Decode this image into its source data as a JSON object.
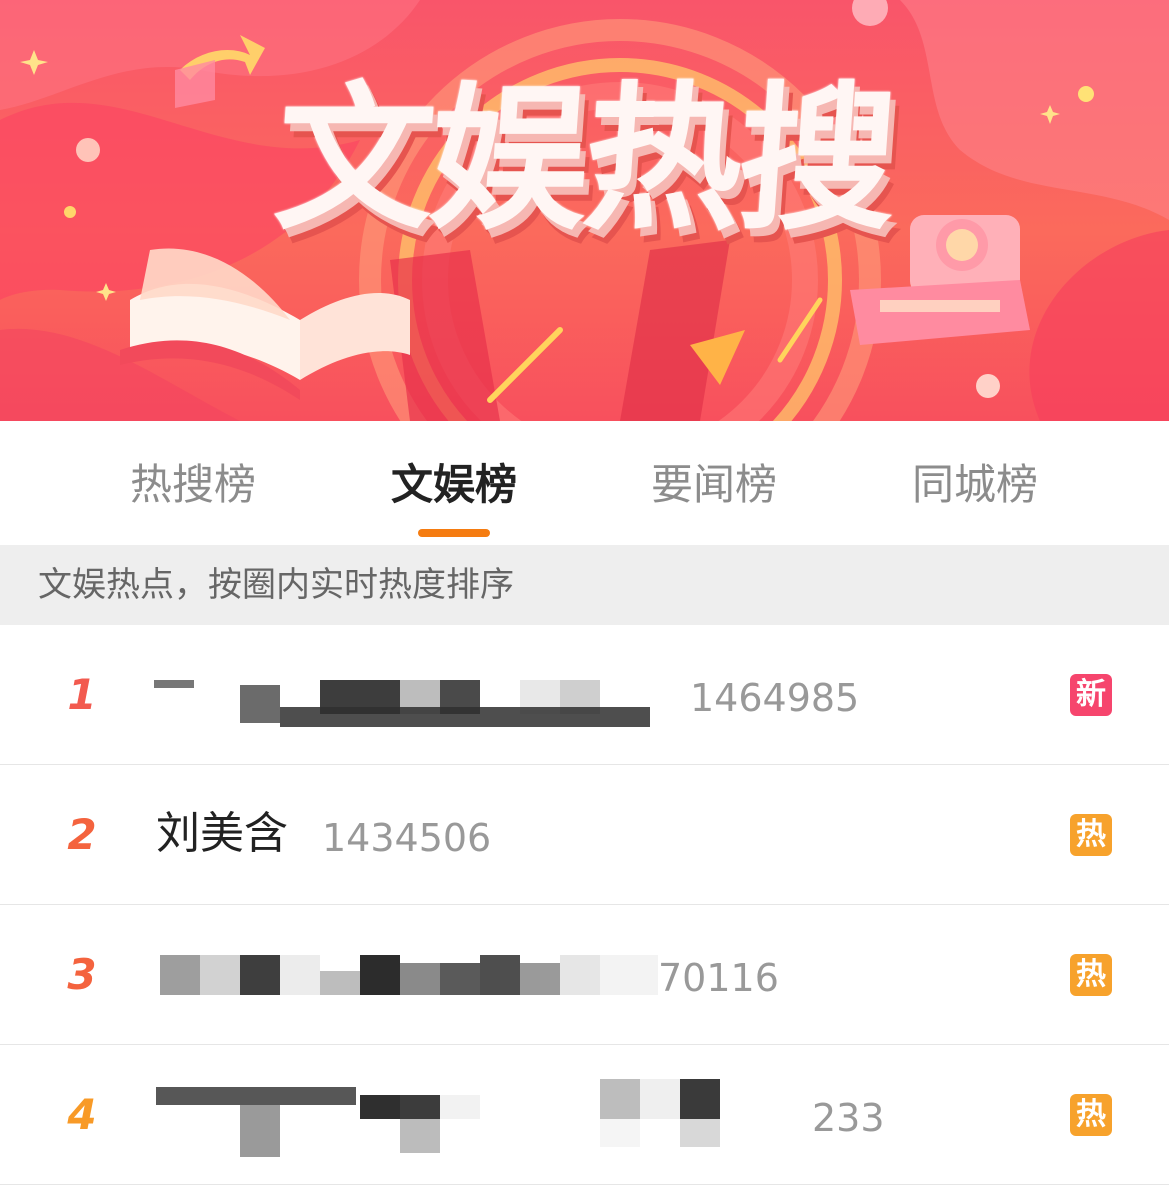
{
  "banner": {
    "title": "文娱热搜",
    "colors": {
      "base": "#f9556a",
      "accent": "#ffcf5a",
      "book": "#fff1ea",
      "camera": "#ff8fa3"
    }
  },
  "tabs": [
    {
      "label": "热搜榜",
      "active": false
    },
    {
      "label": "文娱榜",
      "active": true
    },
    {
      "label": "要闻榜",
      "active": false
    },
    {
      "label": "同城榜",
      "active": false
    }
  ],
  "subtitle": "文娱热点，按圈内实时热度排序",
  "list": [
    {
      "rank": "1",
      "title": "",
      "count": "1464985",
      "badge": "新",
      "badge_color": "#f6456d",
      "rank_color": "#f25a4f"
    },
    {
      "rank": "2",
      "title": "刘美含",
      "count": "1434506",
      "badge": "热",
      "badge_color": "#f7a22c",
      "rank_color": "#f4633e"
    },
    {
      "rank": "3",
      "title": "",
      "count": "70116",
      "badge": "热",
      "badge_color": "#f7a22c",
      "rank_color": "#f4633e"
    },
    {
      "rank": "4",
      "title": "",
      "count": "233",
      "badge": "热",
      "badge_color": "#f7a22c",
      "rank_color": "#f89a27"
    }
  ],
  "colors": {
    "tab_indicator": "#f57c11",
    "subtitle_bg": "#eeeeee"
  }
}
